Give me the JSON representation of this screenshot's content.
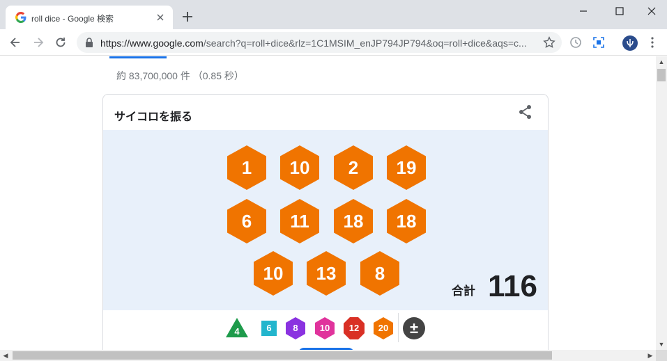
{
  "browser": {
    "tab_title": "roll dice - Google 検索",
    "url_host": "https://www.google.com",
    "url_rest": "/search?q=roll+dice&rlz=1C1MSIM_enJP794JP794&oq=roll+dice&aqs=c..."
  },
  "results": {
    "stats": "約 83,700,000 件 （0.85 秒）"
  },
  "dice_card": {
    "title": "サイコロを振る",
    "dice": [
      "1",
      "10",
      "2",
      "19",
      "6",
      "11",
      "18",
      "18",
      "10",
      "13",
      "8"
    ],
    "total_label": "合計",
    "total_value": "116",
    "die_color": "#f07400",
    "background_color": "#e8f0fa",
    "picker": [
      {
        "label": "4",
        "shape": "triangle",
        "color": "#1e9b4b"
      },
      {
        "label": "6",
        "shape": "square",
        "color": "#23b5cd"
      },
      {
        "label": "8",
        "shape": "hexagon",
        "color": "#8a32e0"
      },
      {
        "label": "10",
        "shape": "hexagon",
        "color": "#e0339c"
      },
      {
        "label": "12",
        "shape": "octagon",
        "color": "#d93025"
      },
      {
        "label": "20",
        "shape": "hexagon",
        "color": "#f07400"
      },
      {
        "label": "±",
        "shape": "circle",
        "color": "#444444"
      }
    ]
  }
}
